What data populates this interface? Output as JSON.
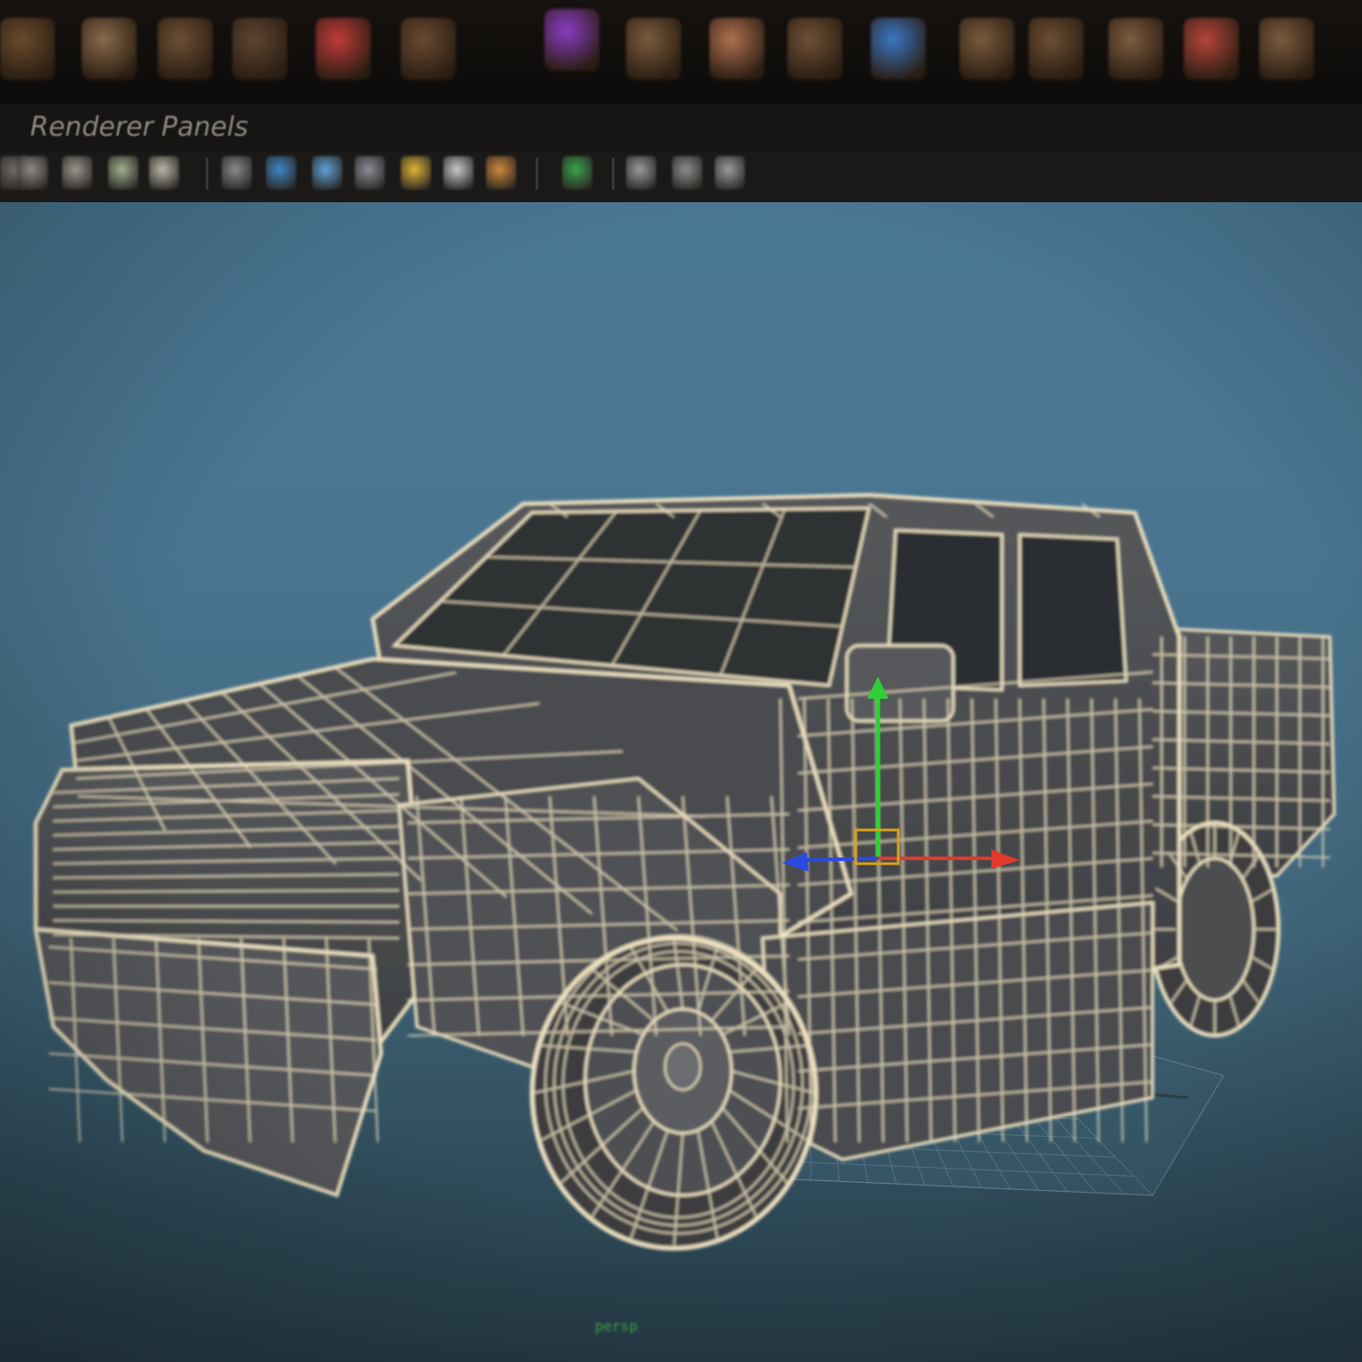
{
  "app": {
    "shelf_tabs": [
      "",
      "",
      "",
      ""
    ],
    "shelf_icons": [
      {
        "name": "shelf-polygon-sphere-icon",
        "color": "#6b4a2c"
      },
      {
        "name": "shelf-polygon-cone-icon",
        "color": "#8a6a4a"
      },
      {
        "name": "shelf-polygon-cylinder-icon",
        "color": "#6d4f33"
      },
      {
        "name": "shelf-polygon-torus-icon",
        "color": "#5f4530"
      },
      {
        "name": "shelf-combine-icon",
        "color": "#c23a3a"
      },
      {
        "name": "shelf-separate-icon",
        "color": "#6a4a32"
      },
      {
        "name": "shelf-bounding-cube-icon",
        "color": "#8b3cc4"
      },
      {
        "name": "shelf-extract-icon",
        "color": "#7a5a3c"
      },
      {
        "name": "shelf-boolean-icon",
        "color": "#b07050"
      },
      {
        "name": "shelf-smooth-icon",
        "color": "#6f5035"
      },
      {
        "name": "shelf-fill-hole-icon",
        "color": "#3a77c4"
      },
      {
        "name": "shelf-mirror-icon",
        "color": "#7a5a3c"
      },
      {
        "name": "shelf-extrude-icon",
        "color": "#6c4e33"
      },
      {
        "name": "shelf-bridge-icon",
        "color": "#7d5d3e"
      },
      {
        "name": "shelf-append-icon",
        "color": "#b5453a"
      },
      {
        "name": "shelf-split-icon",
        "color": "#7b5b3d"
      },
      {
        "name": "shelf-wedge-icon",
        "color": "#6a4c32"
      },
      {
        "name": "shelf-bevel-icon",
        "color": "#735539"
      }
    ],
    "panel_menu": {
      "items": [
        "Renderer",
        "Panels"
      ]
    },
    "panel_toolbar": {
      "icons": [
        {
          "name": "select-camera-icon",
          "color": "#6d6a66"
        },
        {
          "name": "camera-attributes-icon",
          "color": "#8e8a85"
        },
        {
          "name": "bookmark-icon",
          "color": "#9b958e"
        },
        {
          "name": "image-plane-icon",
          "color": "#9fb08d"
        },
        {
          "name": "2d-pan-zoom-icon",
          "color": "#b9b7a8"
        },
        {
          "name": "wireframe-icon",
          "color": "#8a8a8a"
        },
        {
          "name": "smooth-shade-icon",
          "color": "#3f86c9"
        },
        {
          "name": "wireframe-on-shaded-icon",
          "color": "#5ea2d6"
        },
        {
          "name": "xray-icon",
          "color": "#8a8f9a"
        },
        {
          "name": "use-default-light-icon",
          "color": "#e0b534"
        },
        {
          "name": "shadows-icon",
          "color": "#c9c9c9"
        },
        {
          "name": "textured-icon",
          "color": "#d0893a"
        },
        {
          "name": "isolate-select-icon",
          "color": "#3aa34a"
        },
        {
          "name": "grid-toggle-icon",
          "color": "#9a9a9a"
        },
        {
          "name": "resolution-gate-icon",
          "color": "#8d8d8d"
        },
        {
          "name": "film-gate-icon",
          "color": "#9b9b9b"
        }
      ]
    },
    "viewport": {
      "camera_label": "persp",
      "object": "pickup-truck-wireframe-model",
      "display_mode": "wireframe-on-shaded",
      "manipulator": "move-tool"
    }
  },
  "colors": {
    "viewport_top": "#4a7793",
    "viewport_bottom": "#263c47",
    "wire": "#efe3c2",
    "shade": "#6f7072",
    "shade_dark": "#3a3b3d",
    "axis_x": "#e03a2a",
    "axis_y": "#2fcf3a",
    "axis_z": "#2a4be0",
    "manipulator_center": "#d9a21a"
  }
}
